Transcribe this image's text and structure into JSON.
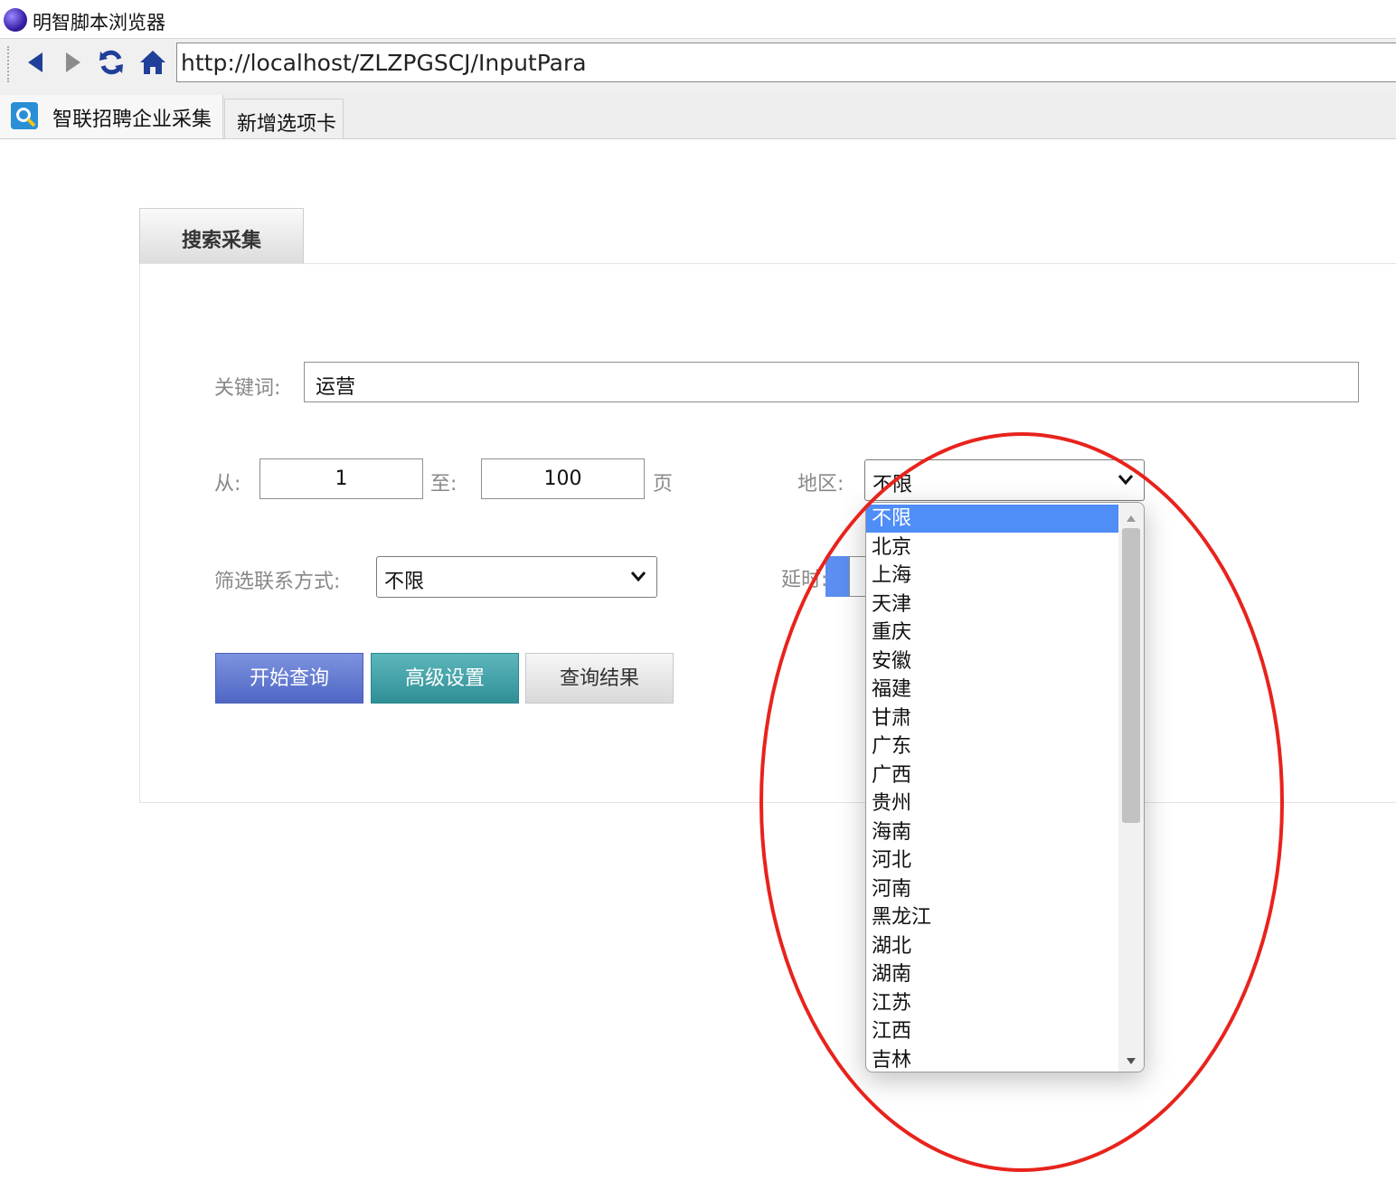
{
  "window": {
    "title": "明智脚本浏览器"
  },
  "navbar": {
    "back_icon": "back-arrow-icon",
    "forward_icon": "forward-arrow-icon",
    "refresh_icon": "refresh-icon",
    "home_icon": "home-icon",
    "url": "http://localhost/ZLZPGSCJ/InputPara"
  },
  "tabs": [
    {
      "label": "智联招聘企业采集",
      "icon": "zhilian-logo-icon",
      "active": true
    },
    {
      "label": "新增选项卡",
      "active": false
    }
  ],
  "panel": {
    "tab_label": "搜索采集"
  },
  "form": {
    "keyword_label": "关键词:",
    "keyword_value": "运营",
    "from_label": "从:",
    "from_value": "1",
    "to_label": "至:",
    "to_value": "100",
    "page_label": "页",
    "region_label": "地区:",
    "region_value": "不限",
    "contact_label": "筛选联系方式:",
    "contact_value": "不限",
    "delay_label": "延时:"
  },
  "buttons": {
    "start": "开始查询",
    "advanced": "高级设置",
    "results": "查询结果"
  },
  "colors": {
    "start_button": "#5b78d0",
    "advanced_button": "#3aa0a6",
    "results_button": "#e6e6e6",
    "selected_option": "#4f8df7",
    "annotation_ellipse": "#e8231c"
  },
  "region_dropdown": {
    "selected": "不限",
    "options": [
      "不限",
      "北京",
      "上海",
      "天津",
      "重庆",
      "安徽",
      "福建",
      "甘肃",
      "广东",
      "广西",
      "贵州",
      "海南",
      "河北",
      "河南",
      "黑龙江",
      "湖北",
      "湖南",
      "江苏",
      "江西",
      "吉林"
    ]
  }
}
